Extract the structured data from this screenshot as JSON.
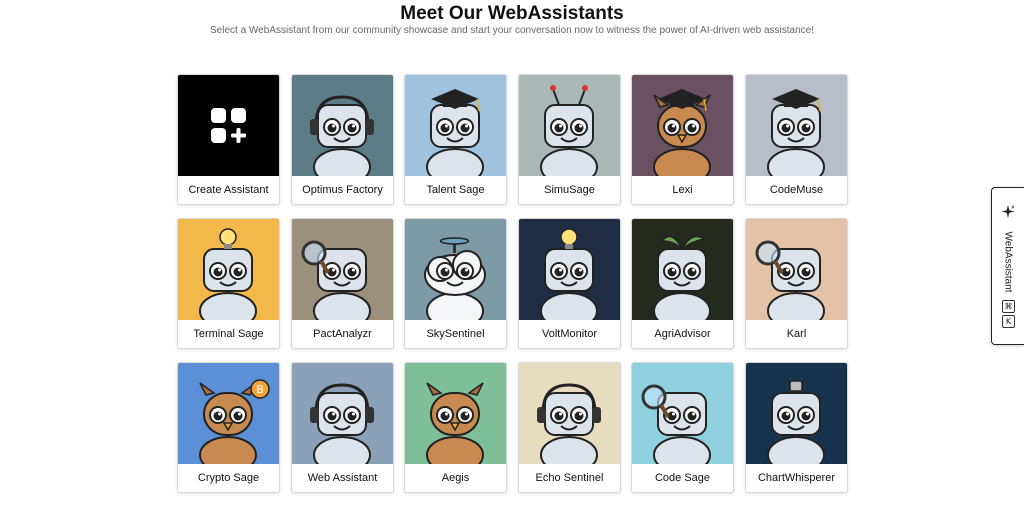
{
  "header": {
    "title": "Meet Our WebAssistants",
    "subtitle": "Select a WebAssistant from our community showcase and start your conversation now to witness the power of AI-driven web assistance!"
  },
  "assistants": [
    {
      "label": "Create Assistant",
      "bg": "#000000",
      "icon": "create-icon"
    },
    {
      "label": "Optimus Factory",
      "bg": "#5e7b88",
      "icon": "robot-headset-icon"
    },
    {
      "label": "Talent Sage",
      "bg": "#9fc3df",
      "icon": "robot-graduate-icon"
    },
    {
      "label": "SimuSage",
      "bg": "#a9b8b5",
      "icon": "robot-antenna-icon"
    },
    {
      "label": "Lexi",
      "bg": "#6a5060",
      "icon": "owl-graduate-icon"
    },
    {
      "label": "CodeMuse",
      "bg": "#b7bdc9",
      "icon": "robot-graduate-icon"
    },
    {
      "label": "Terminal Sage",
      "bg": "#f2b94a",
      "icon": "robot-lightbulb-icon"
    },
    {
      "label": "PactAnalyzr",
      "bg": "#9c8f7b",
      "icon": "robot-magnifier-icon"
    },
    {
      "label": "SkySentinel",
      "bg": "#7d9aa6",
      "icon": "cloud-propeller-icon"
    },
    {
      "label": "VoltMonitor",
      "bg": "#1f2d44",
      "icon": "robot-lightbulb-icon"
    },
    {
      "label": "AgriAdvisor",
      "bg": "#252a1e",
      "icon": "plant-robot-icon"
    },
    {
      "label": "Karl",
      "bg": "#e4c2a8",
      "icon": "robot-magnifier-icon"
    },
    {
      "label": "Crypto Sage",
      "bg": "#5b8fd6",
      "icon": "owl-bitcoin-icon"
    },
    {
      "label": "Web Assistant",
      "bg": "#8aa1b8",
      "icon": "robot-headset-icon"
    },
    {
      "label": "Aegis",
      "bg": "#7fbf98",
      "icon": "owl-icon"
    },
    {
      "label": "Echo Sentinel",
      "bg": "#e8dcc0",
      "icon": "robot-headphones-icon"
    },
    {
      "label": "Code Sage",
      "bg": "#8fd0de",
      "icon": "robot-magnifier-icon"
    },
    {
      "label": "ChartWhisperer",
      "bg": "#17324d",
      "icon": "robot-chart-icon"
    }
  ],
  "side_tab": {
    "label": "WebAssistant",
    "icon": "sparkle-icon",
    "shortcut": [
      "⌘",
      "K"
    ]
  }
}
